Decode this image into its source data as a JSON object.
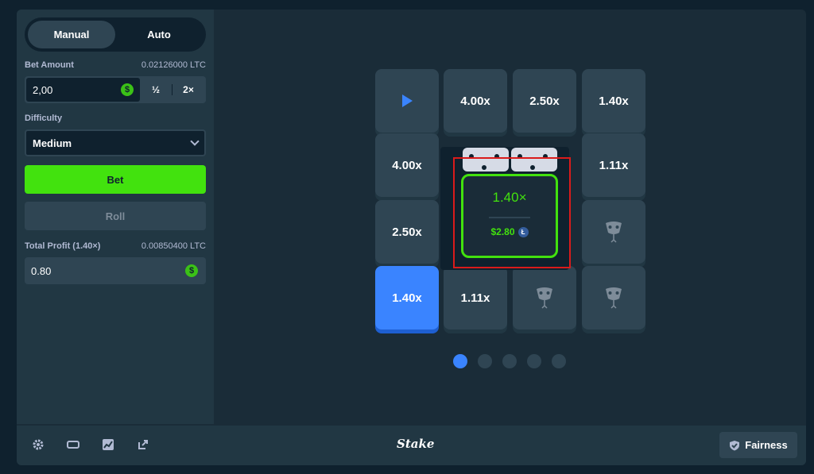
{
  "sidebar": {
    "modes": [
      "Manual",
      "Auto"
    ],
    "bet_amount": {
      "label": "Bet Amount",
      "ltc_value": "0.02126000 LTC",
      "value": "2,00",
      "half": "½",
      "double": "2×"
    },
    "difficulty": {
      "label": "Difficulty",
      "selected": "Medium"
    },
    "bet_button": "Bet",
    "roll_button": "Roll",
    "profit": {
      "label": "Total Profit (1.40×)",
      "ltc_value": "0.00850400 LTC",
      "value": "0.80"
    },
    "coin_symbol": "$"
  },
  "grid": {
    "r0c1": "4.00x",
    "r0c2": "2.50x",
    "r0c3": "1.40x",
    "r1c0": "4.00x",
    "r1c3": "1.11x",
    "r2c0": "2.50x",
    "r3c0": "1.40x",
    "r3c1": "1.11x"
  },
  "result": {
    "multiplier": "1.40×",
    "amount": "$2.80",
    "currency_symbol": "Ł"
  },
  "pagination": {
    "count": 5,
    "active": 1
  },
  "footer": {
    "logo": "Stake",
    "fairness": "Fairness"
  },
  "colors": {
    "green": "#42e20e",
    "blue": "#3a84ff",
    "highlight_red": "#d91b1b"
  }
}
